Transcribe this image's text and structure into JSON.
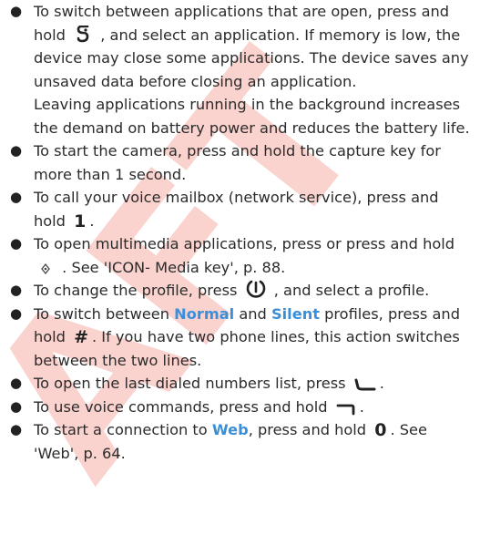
{
  "watermark": {
    "color": "#e8321e"
  },
  "items": [
    {
      "text1": "To switch between applications that are open, press and hold",
      "icon": "menu-key-icon",
      "text2": ", and select an application. If memory is low, the device may close some applications. The device saves any unsaved data before closing an application.",
      "para2": "Leaving applications running in the background increases the demand on battery power and reduces the battery life."
    },
    {
      "text": "To start the camera, press and hold the capture key for more than 1 second."
    },
    {
      "text1": "To call your voice mailbox (network service), press and hold",
      "key": "1",
      "text2": "."
    },
    {
      "text1": "To open multimedia applications, press or press and hold",
      "icon": "media-key-icon",
      "text2": ". See 'ICON- Media key', p. 88."
    },
    {
      "text1": "To change the profile, press",
      "icon": "power-key-icon",
      "text2": ", and select a profile."
    },
    {
      "text1": "To switch between",
      "kw1": "Normal",
      "text2": "and",
      "kw2": "Silent",
      "text3": "profiles, press and hold",
      "key": "#",
      "text4": ". If you have two phone lines, this action switches between the two lines."
    },
    {
      "text1": "To open the last dialed numbers list, press",
      "icon": "call-key-icon",
      "text2": "."
    },
    {
      "text1": "To use voice commands, press and hold",
      "icon": "right-selection-key-icon",
      "text2": "."
    },
    {
      "text1": "To start a connection to",
      "kw": "Web",
      "text2": ", press and hold",
      "key": "0",
      "text3": ". See 'Web', p. 64."
    }
  ]
}
